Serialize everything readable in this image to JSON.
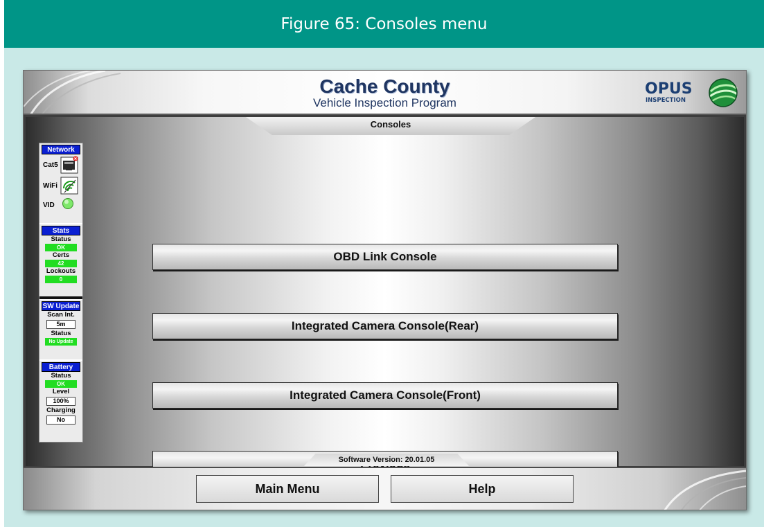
{
  "figure": {
    "caption": "Figure 65: Consoles menu"
  },
  "banner": {
    "title": "Cache County",
    "subtitle": "Vehicle Inspection Program",
    "logo_text": "OPUS",
    "logo_subtext": "INSPECTION"
  },
  "screen": {
    "title": "Consoles",
    "software_version": "Software Version: 20.01.05"
  },
  "status_panel": {
    "network": {
      "header": "Network",
      "cat5_label": "Cat5",
      "wifi_label": "WiFi",
      "vid_label": "VID",
      "icons": {
        "cat5": "ethernet-port-icon",
        "wifi": "wifi-icon",
        "vid": "status-led-icon"
      }
    },
    "stats": {
      "header": "Stats",
      "status_label": "Status",
      "status_value": "OK",
      "certs_label": "Certs",
      "certs_value": "42",
      "lockouts_label": "Lockouts",
      "lockouts_value": "0"
    },
    "sw_update": {
      "header": "SW Update",
      "scan_label": "Scan Int.",
      "scan_value": "5m",
      "status_label": "Status",
      "status_value": "No Update"
    },
    "battery": {
      "header": "Battery",
      "status_label": "Status",
      "status_value": "OK",
      "level_label": "Level",
      "level_value": "100%",
      "charging_label": "Charging",
      "charging_value": "No"
    }
  },
  "menu_buttons": [
    {
      "label": "OBD Link Console"
    },
    {
      "label": "Integrated Camera Console(Rear)"
    },
    {
      "label": "Integrated Camera Console(Front)"
    },
    {
      "label": "Previous"
    }
  ],
  "footer": {
    "main_menu_label": "Main Menu",
    "help_label": "Help"
  },
  "colors": {
    "figure_header": "#009587",
    "figure_background": "#c9e9e7",
    "title_blue": "#1f3561",
    "panel_header_blue": "#0a1fd2",
    "status_green": "#22dd22"
  }
}
